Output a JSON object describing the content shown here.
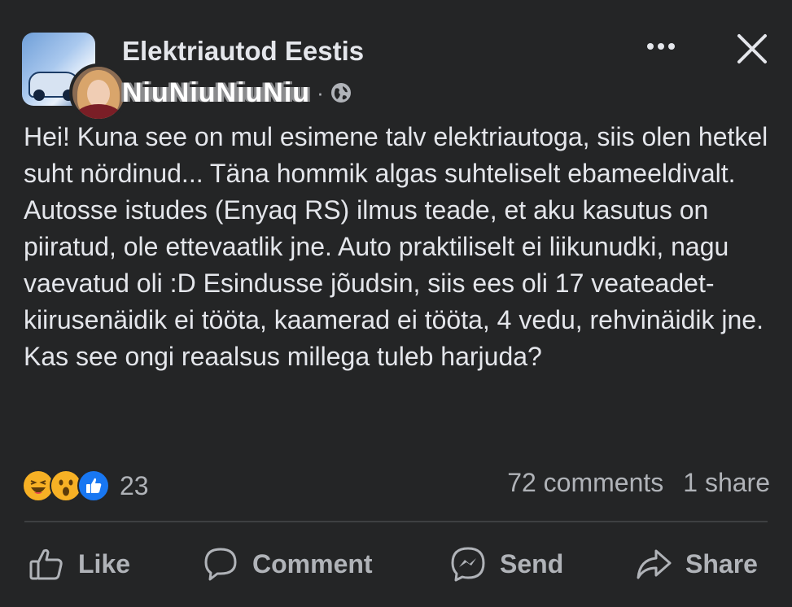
{
  "post": {
    "group_name": "Elektriautod Eestis",
    "author_name": "NiuNiuNiuNiu",
    "privacy_icon": "globe-icon",
    "meta_separator": "·",
    "body": "Hei! Kuna see on mul esimene talv elektriautoga, siis olen hetkel suht nördinud... Täna hommik algas suhteliselt ebameeldivalt. Autosse istudes (Enyaq RS) ilmus teade, et aku kasutus on piiratud, ole ettevaatlik jne. Auto praktiliselt ei liikunudki, nagu vaevatud oli :D Esindusse jõudsin, siis ees oli 17 veateadet- kiirusenäidik ei tööta, kaamerad ei tööta, 4 vedu, rehvinäidik jne. Kas see ongi reaalsus millega tuleb harjuda?"
  },
  "reactions": {
    "icons": [
      "haha",
      "wow",
      "like"
    ],
    "count": "23"
  },
  "stats": {
    "comments": "72 comments",
    "shares": "1 share"
  },
  "actions": {
    "like": "Like",
    "comment": "Comment",
    "send": "Send",
    "share": "Share"
  },
  "colors": {
    "background": "#242526",
    "text": "#e4e6eb",
    "secondary": "#b0b3b8",
    "like_blue": "#1877f2",
    "emoji_yellow": "#f7b125"
  }
}
